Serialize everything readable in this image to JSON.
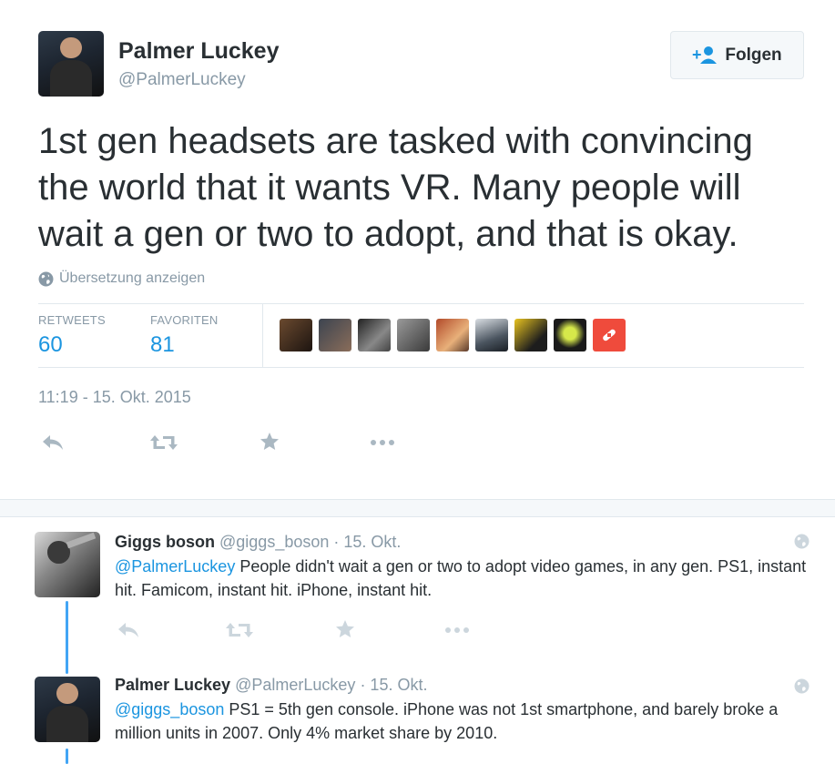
{
  "main_tweet": {
    "author_name": "Palmer Luckey",
    "author_handle": "@PalmerLuckey",
    "follow_label": "Folgen",
    "text": "1st gen headsets are tasked with convincing the world that it wants VR.  Many people will wait a gen or two to adopt, and that is okay.",
    "translate_label": "Übersetzung anzeigen",
    "stats": {
      "retweets_label": "RETWEETS",
      "retweets_count": "60",
      "favorites_label": "FAVORITEN",
      "favorites_count": "81"
    },
    "timestamp": "11:19 - 15. Okt. 2015",
    "icons": [
      "reply-icon",
      "retweet-icon",
      "favorite-icon",
      "more-icon"
    ]
  },
  "replies": [
    {
      "author_name": "Giggs boson",
      "author_handle": "@giggs_boson",
      "date": "· 15. Okt.",
      "mention": "@PalmerLuckey",
      "text": " People didn't wait a gen or two to adopt video games, in any gen. PS1, instant hit. Famicom, instant hit. iPhone, instant hit."
    },
    {
      "author_name": "Palmer Luckey",
      "author_handle": "@PalmerLuckey",
      "date": "· 15. Okt.",
      "mention": "@giggs_boson",
      "text": " PS1 = 5th gen console. iPhone was not 1st smartphone, and barely broke a million units in 2007. Only 4% market share by 2010."
    }
  ],
  "colors": {
    "accent": "#1b95e0",
    "thread_line": "#42a5f5",
    "muted": "#8899a6",
    "text": "#292f33"
  }
}
